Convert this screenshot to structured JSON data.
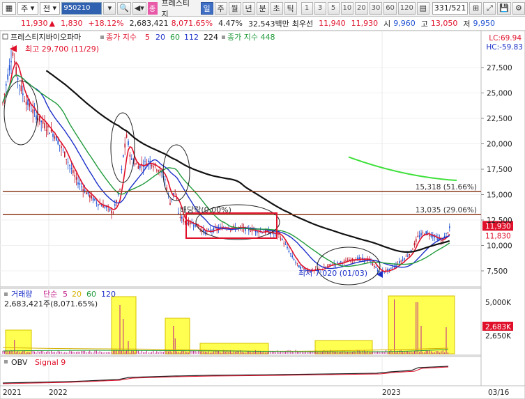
{
  "toolbar": {
    "market": "주",
    "period": "전",
    "code": "950210",
    "name_badge": "종",
    "name": "프레스티지",
    "intervals": [
      "일",
      "주",
      "월",
      "년",
      "분",
      "초",
      "틱"
    ],
    "active_interval": "일",
    "nums": [
      "1",
      "3",
      "5",
      "10",
      "20",
      "30",
      "60",
      "120"
    ],
    "page_current": "331",
    "page_total": "/521"
  },
  "infobar": {
    "price": "11,930",
    "change": "1,830",
    "change_pct": "+18.12%",
    "volume": "2,683,421",
    "vol_pct": "8,071.65%",
    "turnover": "4.47%",
    "amount": "32,543백만",
    "meta_label": "최우선",
    "bid1": "11,940",
    "bid2": "11,930",
    "open_label": "시",
    "open": "9,960",
    "high_label": "고",
    "high": "13,050",
    "low_label": "저",
    "low": "9,950"
  },
  "price_panel": {
    "legend_name": "프레스티지바이오파마",
    "legend_ma_label": "종가 지수",
    "legend_ma_periods": [
      "5",
      "20",
      "60",
      "112",
      "224"
    ],
    "legend_ma448": "종가 지수 448",
    "lc": "LC:69.94",
    "hc": "HC:-59.83",
    "high_note": "최고 29,700 (11/29)",
    "low_note": "최저 7,020 (01/03)",
    "overlay_note": "배당락(0.00%)",
    "level1_label": "15,318 (51.66%)",
    "level1": 15318,
    "level2_label": "13,035 (29.06%)",
    "level2": 13035,
    "price_tag": "11,930",
    "price_tag2": "11,830",
    "y_ticks": [
      "27,500",
      "25,000",
      "22,500",
      "20,000",
      "17,500",
      "15,000",
      "12,500",
      "10,000",
      "7,500"
    ]
  },
  "volume_panel": {
    "legend": "거래량",
    "legend_ma": "단순",
    "legend_periods": [
      "5",
      "20",
      "60",
      "120"
    ],
    "value_text": "2,683,421주(8,071.65%)",
    "y_ticks": [
      "5,000K",
      "2,650K"
    ],
    "tag": "2,683K"
  },
  "obv_panel": {
    "legend": "OBV",
    "signal": "Signal 9"
  },
  "x_axis": {
    "labels": [
      "2021",
      "2022",
      "2023",
      "03/16"
    ]
  },
  "colors": {
    "ma5": "#e0102a",
    "ma20": "#1b2fc8",
    "ma60": "#1f9a3a",
    "ma112": "#111111",
    "ma448": "#3ee03a",
    "level": "#8b3a1a",
    "highlight": "#ffff33",
    "candle": "#c0182c"
  }
}
